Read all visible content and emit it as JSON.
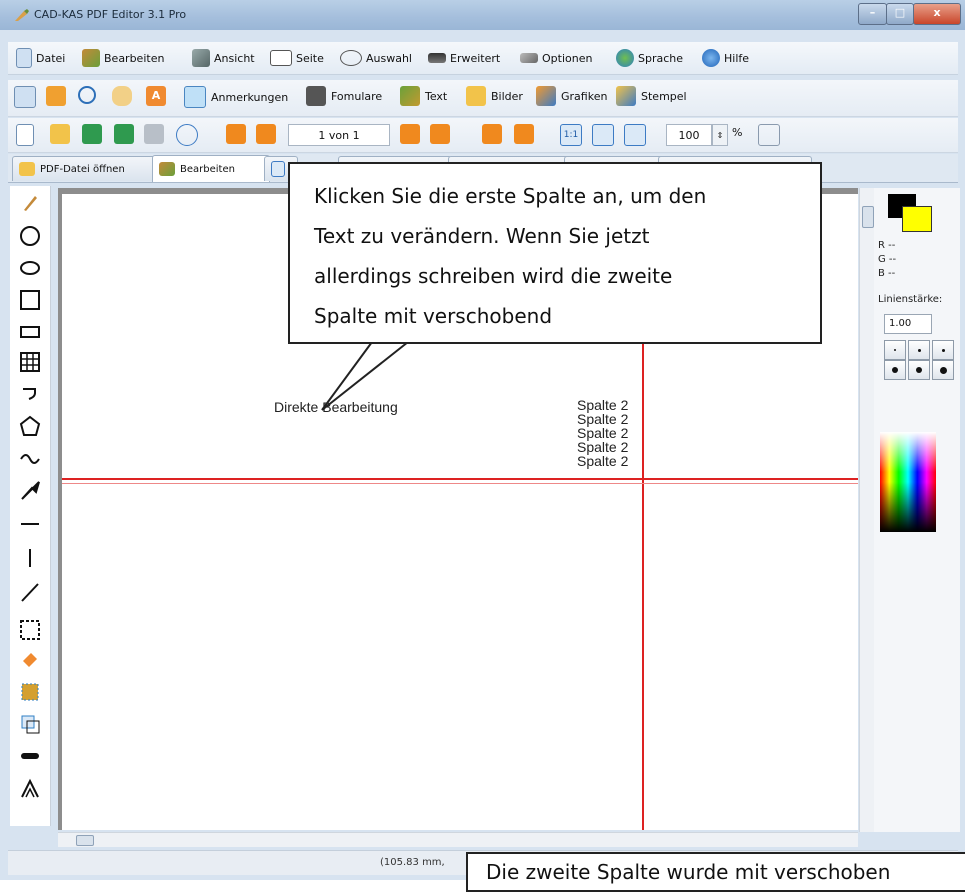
{
  "window": {
    "title": "CAD-KAS PDF Editor 3.1 Pro",
    "min": "–",
    "max": "□",
    "close": "x"
  },
  "menu": [
    "Datei",
    "Bearbeiten",
    "Ansicht",
    "Seite",
    "Auswahl",
    "Erweitert",
    "Optionen",
    "Sprache",
    "Hilfe"
  ],
  "toolbar1": {
    "anmerkungen": "Anmerkungen",
    "formulare": "Fomulare",
    "text": "Text",
    "bilder": "Bilder",
    "grafiken": "Grafiken",
    "stempel": "Stempel"
  },
  "toolbar2": {
    "page_counter": "1 von 1",
    "ratio_label": "1:1",
    "zoom_value": "100",
    "zoom_unit": "%"
  },
  "tabs": {
    "open_pdf": "PDF-Datei öffnen",
    "edit": "Bearbeiten"
  },
  "document": {
    "direct_edit": "Direkte Bearbeitung",
    "column2": [
      "Spalte 2",
      "Spalte 2",
      "Spalte 2",
      "Spalte 2",
      "Spalte 2"
    ]
  },
  "right_panel": {
    "r": "R --",
    "g": "G --",
    "b": "B --",
    "line_width_label": "Linienstärke:",
    "line_width_value": "1.00"
  },
  "status": {
    "coords": "(105.83 mm,"
  },
  "callouts": {
    "callout1": [
      "Klicken Sie die erste Spalte an, um den",
      "Text zu verändern. Wenn Sie jetzt",
      "allerdings schreiben wird die zweite",
      "Spalte mit verschobend"
    ],
    "callout2": "Die zweite Spalte wurde mit verschoben"
  }
}
